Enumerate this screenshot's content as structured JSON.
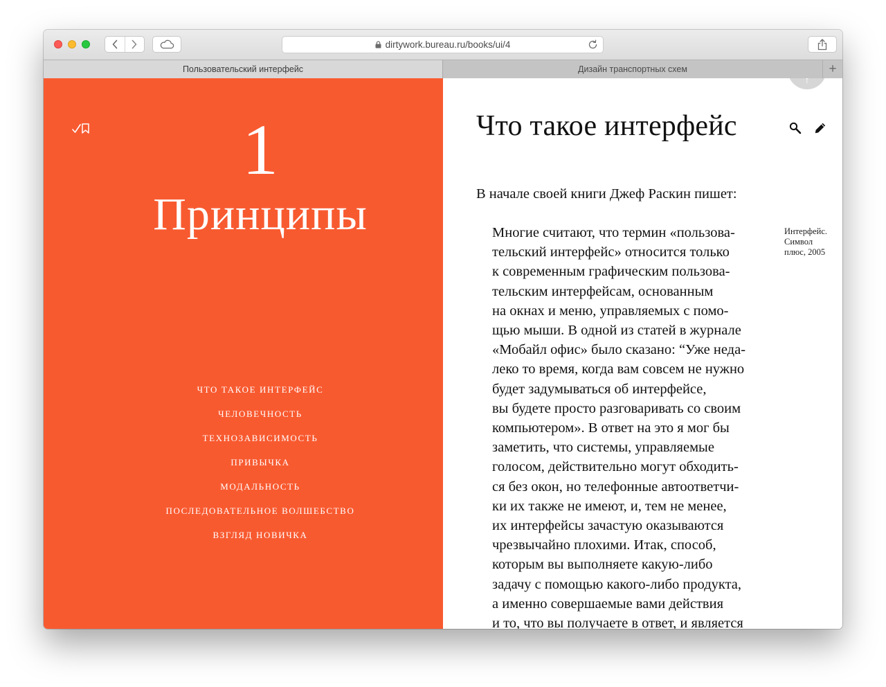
{
  "browser": {
    "url": "dirtywork.bureau.ru/books/ui/4",
    "tabs": [
      {
        "label": "Пользовательский интерфейс",
        "active": true
      },
      {
        "label": "Дизайн транспортных схем",
        "active": false
      }
    ],
    "new_tab_label": "+",
    "nav": {
      "back": "‹",
      "forward": "›"
    }
  },
  "sidebar": {
    "accent_color": "#f85a30",
    "chapter_number": "1",
    "chapter_title": "Принципы",
    "toc": [
      "Что такое интерфейс",
      "Человечность",
      "Технозависимость",
      "Привычка",
      "Модальность",
      "Последовательное волшебство",
      "Взгляд новичка"
    ]
  },
  "article": {
    "title": "Что такое интерфейс",
    "intro": "В начале своей книги Джеф Раскин пишет:",
    "quote_lines": [
      "Многие считают, что термин «пользова-",
      "тельский интерфейс» относится только",
      "к современным графическим пользова-",
      "тельским интерфейсам, основанным",
      "на окнах и меню, управляемых с помо-",
      "щью мыши. В одной из статей в журнале",
      "«Мобайл офис» было сказано: “Уже неда-",
      "леко то время, когда вам совсем не нужно",
      "будет задумываться об интерфейсе,",
      "вы будете просто разговаривать со своим",
      "компьютером». В ответ на это я мог бы",
      "заметить, что системы, управляемые",
      "голосом, действительно могут обходить-",
      "ся без окон, но телефонные автоответчи-",
      "ки их также не имеют, и, тем не менее,",
      "их интерфейсы зачастую оказываются",
      "чрезвычайно плохими. Итак, способ,",
      "которым вы выполняете какую-либо",
      "задачу с помощью какого-либо продукта,",
      "а именно совершаемые вами действия",
      "и то, что вы получаете в ответ, и является"
    ],
    "sidenote_lines": [
      "Интерфейс.",
      "Символ",
      "плюс, 2005"
    ],
    "circle_label": "↑"
  }
}
